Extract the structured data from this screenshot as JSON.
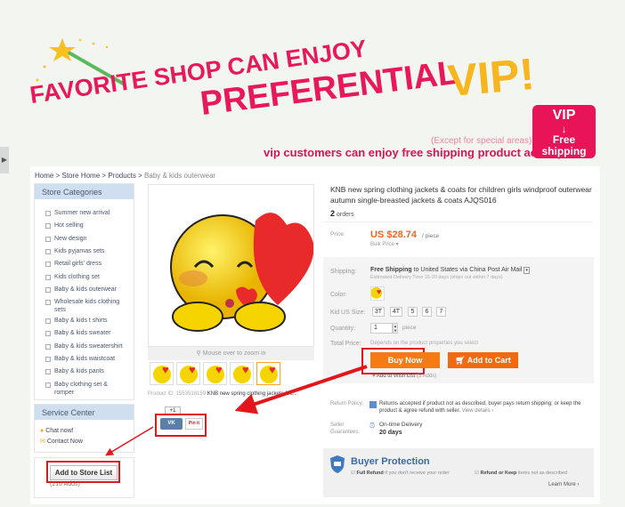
{
  "banner": {
    "line1": "FAVORITE SHOP CAN ENJOY",
    "line2": "PREFERENTIAL",
    "vip": "VIP!",
    "except": "(Except for special areas)",
    "tagline": "vip customers can enjoy free shipping product activity",
    "badge_top": "VIP",
    "badge_arrow": "↓",
    "badge_mid": "Free",
    "badge_bottom": "shipping"
  },
  "side_tab_icon": "chevron-right-icon",
  "breadcrumb": [
    "Home",
    "Store Home",
    "Products",
    "Baby & kids outerwear"
  ],
  "breadcrumb_sep": ">",
  "sidebar": {
    "categories_title": "Store Categories",
    "categories": [
      "Summer new arrival",
      "Hot selling",
      "New design",
      "Kids pyjamas sets",
      "Retail girls' dress",
      "Kids clothing set",
      "Baby & kids outerwear",
      "Wholesale kids clothing sets",
      "Baby & kids t shirts",
      "Baby & kids sweater",
      "Baby & kids sweatershirt",
      "Baby & kids waistcoat",
      "Baby & kids pants",
      "Baby clothing set & romper"
    ],
    "service_title": "Service Center",
    "chat": "Chat now!",
    "contact": "Contact Now",
    "add_store": "Add to Store List",
    "adds": "(216 Adds)"
  },
  "gallery": {
    "zoom_hint": "Mouse over to zoom in",
    "product_id_label": "Product ID:",
    "product_id": "1553518159",
    "product_name_short": "KNB new spring clothing jackets & c...",
    "plus_one": "+1",
    "share_vk": "VK",
    "share_pin": "Pin it"
  },
  "product": {
    "title": "KNB new spring clothing jackets & coats for children girls windproof outerwear autumn single-breasted jackets & coats AJQS016",
    "orders_count": "2",
    "orders_label": "orders",
    "price_label": "Price:",
    "price": "US $28.74",
    "price_unit": "/ piece",
    "bulk": "Bulk Price ▾",
    "shipping_label": "Shipping:",
    "shipping_free": "Free Shipping",
    "shipping_to": "to United States via China Post Air Mail",
    "shipping_est": "Estimated Delivery Time 15-20 days (ships out within 7 days)",
    "color_label": "Color:",
    "size_label": "Kid US Size:",
    "sizes": [
      "3T",
      "4T",
      "5",
      "6",
      "7"
    ],
    "qty_label": "Quantity:",
    "qty": "1",
    "qty_unit": "piece",
    "total_label": "Total Price:",
    "total": "Depends on the product properties you select",
    "buy_now": "Buy Now",
    "add_cart": "Add to Cart",
    "wishlist": "Add to Wish List",
    "wish_adds": "(5 Adds)",
    "return_label": "Return Policy:",
    "return_text": "Returns accepted if product not as described, buyer pays return shipping; or keep the product & agree refund with seller.",
    "view_details": "View details ›",
    "seller_label": "Seller Guarantees:",
    "ontime": "On-time Delivery",
    "ontime_days": "20 days",
    "bp_title": "Buyer Protection",
    "bp_full": "Full Refund",
    "bp_full_rest": "if you don't receive your order",
    "bp_keep": "Refund or Keep",
    "bp_keep_rest": "items not as described",
    "learn_more": "Learn More ›"
  },
  "colors": {
    "accent": "#e8185a",
    "price": "#f26522",
    "button": "#f57b12",
    "annotation": "#e3161c",
    "header_blue": "#cfdff0"
  }
}
